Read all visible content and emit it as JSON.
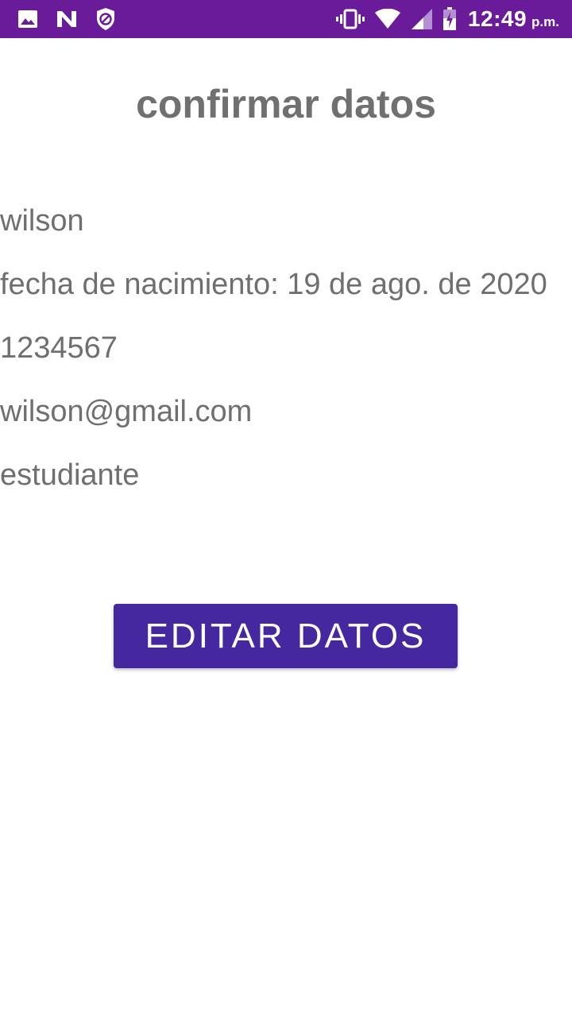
{
  "status_bar": {
    "time": "12:49",
    "ampm": "p.m.",
    "left_icons": [
      "image-icon",
      "n-logo-icon",
      "blocked-shield-icon"
    ],
    "right_icons": [
      "vibrate-icon",
      "wifi-icon",
      "cell-signal-icon",
      "battery-charging-icon"
    ],
    "background_color": "#6a1b9a"
  },
  "main": {
    "title": "confirmar datos",
    "fields": {
      "name": "wilson",
      "birth_date": "fecha de nacimiento: 19 de ago. de 2020",
      "phone": "1234567",
      "email": "wilson@gmail.com",
      "occupation": "estudiante"
    },
    "edit_button_label": "EDITAR DATOS",
    "button_color": "#4527a0"
  }
}
